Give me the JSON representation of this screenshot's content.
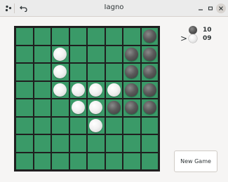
{
  "window": {
    "title": "Iagno",
    "menu_icon": "⁘",
    "undo_icon": "↶",
    "minimize_icon": "−",
    "maximize_icon": "▫",
    "close_icon": "✕"
  },
  "scores": {
    "black": {
      "value": "10",
      "color": "dark"
    },
    "white": {
      "value": "09",
      "color": "light"
    },
    "turn_indicator": ">",
    "current_turn": "white"
  },
  "board": {
    "size": 8,
    "legend": "b = dark disc, w = light disc, . = empty",
    "rows": [
      ".......b",
      "..w...bb",
      "..w...bb",
      "..wwwwbb",
      "...wwbbb",
      "....w...",
      "........",
      "........"
    ]
  },
  "controls": {
    "new_game_label": "New Game"
  },
  "colors": {
    "board_green": "#3a9a68",
    "grid_line": "#1f1f1f",
    "background": "#f6f5f4"
  }
}
